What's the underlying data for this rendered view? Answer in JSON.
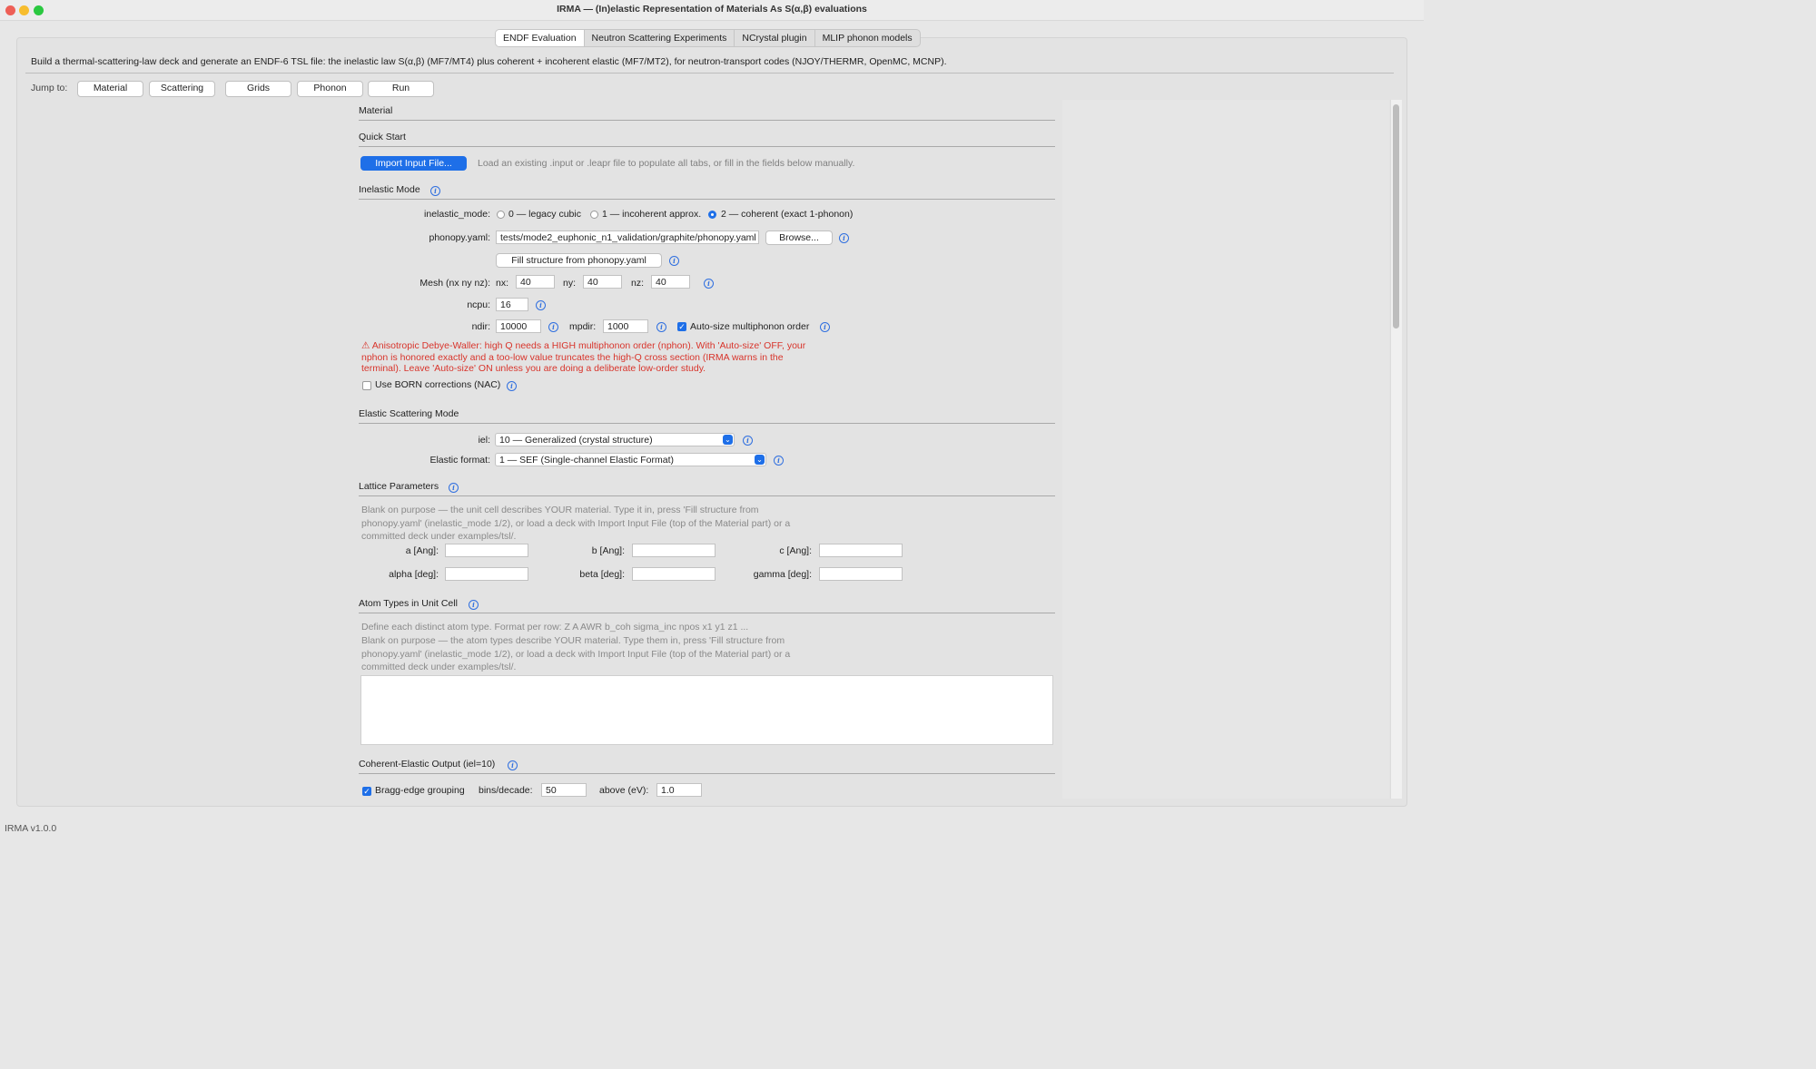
{
  "window": {
    "title": "IRMA — (In)elastic Representation of Materials As S(α,β) evaluations",
    "traffic_colors": [
      "#ee5f56",
      "#f7bd2e",
      "#2ac840"
    ]
  },
  "tabs": [
    {
      "label": "ENDF Evaluation",
      "active": true
    },
    {
      "label": "Neutron Scattering Experiments",
      "active": false
    },
    {
      "label": "NCrystal plugin",
      "active": false
    },
    {
      "label": "MLIP phonon models",
      "active": false
    }
  ],
  "description": "Build a thermal-scattering-law deck and generate an ENDF-6 TSL file: the inelastic law S(α,β) (MF7/MT4) plus coherent + incoherent elastic (MF7/MT2), for neutron-transport codes (NJOY/THERMR, OpenMC, MCNP).",
  "jump": {
    "label": "Jump to:",
    "buttons": [
      "Material",
      "Scattering",
      "Grids",
      "Phonon",
      "Run"
    ]
  },
  "sections": {
    "material": "Material",
    "quick_start": "Quick Start",
    "inelastic_mode": "Inelastic Mode",
    "elastic_mode": "Elastic Scattering Mode",
    "lattice": "Lattice Parameters",
    "atoms": "Atom Types in Unit Cell",
    "coherent_output": "Coherent-Elastic Output (iel=10)"
  },
  "quick_start": {
    "import_button": "Import Input File...",
    "hint": "Load an existing .input or .leapr file to populate all tabs, or fill in the fields below manually."
  },
  "inelastic": {
    "mode_label": "inelastic_mode:",
    "options": [
      "0 — legacy cubic",
      "1 — incoherent approx.",
      "2 — coherent (exact 1-phonon)"
    ],
    "selected_index": 2,
    "phonopy_label": "phonopy.yaml:",
    "phonopy_value": "tests/mode2_euphonic_n1_validation/graphite/phonopy.yaml",
    "browse_button": "Browse...",
    "fill_button": "Fill structure from phonopy.yaml",
    "mesh_label": "Mesh (nx ny nz):",
    "nx_label": "nx:",
    "nx_value": "40",
    "ny_label": "ny:",
    "ny_value": "40",
    "nz_label": "nz:",
    "nz_value": "40",
    "ncpu_label": "ncpu:",
    "ncpu_value": "16",
    "ndir_label": "ndir:",
    "ndir_value": "10000",
    "mpdir_label": "mpdir:",
    "mpdir_value": "1000",
    "autosize_label": "Auto-size multiphonon order",
    "autosize_checked": true,
    "warning_lines": [
      "⚠ Anisotropic Debye-Waller: high Q needs a HIGH multiphonon order (nphon). With 'Auto-size' OFF, your",
      "nphon is honored exactly and a too-low value truncates the high-Q cross section (IRMA warns in the",
      "terminal). Leave 'Auto-size' ON unless you are doing a deliberate low-order study."
    ],
    "born_label": "Use BORN corrections (NAC)",
    "born_checked": false
  },
  "elastic": {
    "iel_label": "iel:",
    "iel_value": "10 — Generalized (crystal structure)",
    "format_label": "Elastic format:",
    "format_value": "1 — SEF (Single-channel Elastic Format)"
  },
  "lattice": {
    "hint_lines": [
      "Blank on purpose — the unit cell describes YOUR material. Type it in, press 'Fill structure from",
      "phonopy.yaml' (inelastic_mode 1/2), or load a deck with Import Input File (top of the Material part) or a",
      "committed deck under examples/tsl/."
    ],
    "a_label": "a [Ang]:",
    "b_label": "b [Ang]:",
    "c_label": "c [Ang]:",
    "alpha_label": "alpha [deg]:",
    "beta_label": "beta [deg]:",
    "gamma_label": "gamma [deg]:"
  },
  "atoms": {
    "format_line": "Define each distinct atom type. Format per row:  Z  A  AWR  b_coh  sigma_inc  npos  x1 y1 z1 ...",
    "hint_lines": [
      "Blank on purpose — the atom types describe YOUR material. Type them in, press 'Fill structure from",
      "phonopy.yaml' (inelastic_mode 1/2), or load a deck with Import Input File (top of the Material part) or a",
      "committed deck under examples/tsl/."
    ]
  },
  "coherent": {
    "bragg_label": "Bragg-edge grouping",
    "bragg_checked": true,
    "bins_label": "bins/decade:",
    "bins_value": "50",
    "above_label": "above (eV):",
    "above_value": "1.0"
  },
  "status": "IRMA v1.0.0",
  "accent_color": "#1e6fe8",
  "warning_color": "#d8342b"
}
